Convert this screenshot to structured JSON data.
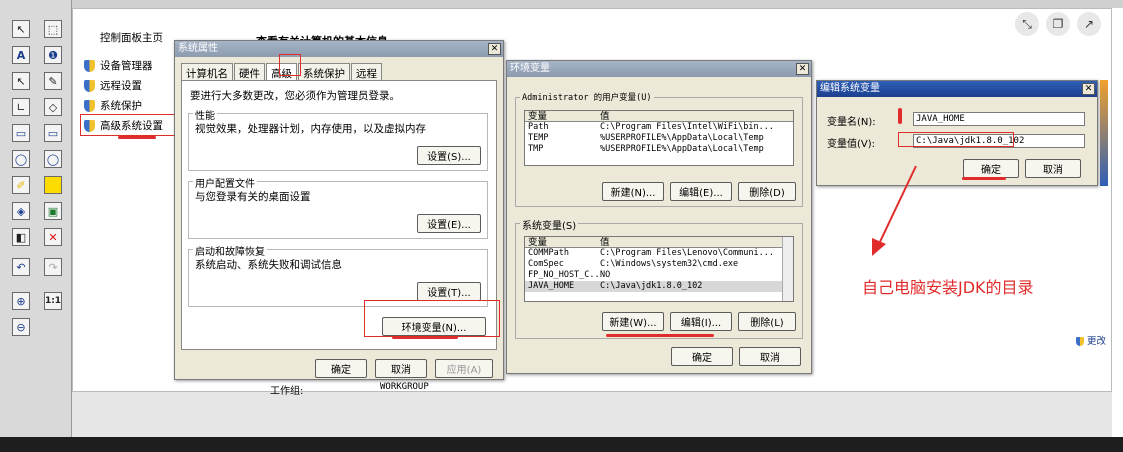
{
  "control_panel": {
    "home": "控制面板主页",
    "links": [
      "设备管理器",
      "远程设置",
      "系统保护",
      "高级系统设置"
    ],
    "heading": "查看有关计算机的基本信息",
    "workgroup_label": "工作组:",
    "workgroup_value": "WORKGROUP",
    "change_settings": "更改"
  },
  "sysprops": {
    "title": "系统属性",
    "tabs": [
      "计算机名",
      "硬件",
      "高级",
      "系统保护",
      "远程"
    ],
    "admin_note": "要进行大多数更改，您必须作为管理员登录。",
    "perf_label": "性能",
    "perf_desc": "视觉效果，处理器计划，内存使用，以及虚拟内存",
    "perf_btn": "设置(S)...",
    "profile_label": "用户配置文件",
    "profile_desc": "与您登录有关的桌面设置",
    "profile_btn": "设置(E)...",
    "startup_label": "启动和故障恢复",
    "startup_desc": "系统启动、系统失败和调试信息",
    "startup_btn": "设置(T)...",
    "env_btn": "环境变量(N)...",
    "ok": "确定",
    "cancel": "取消",
    "apply": "应用(A)"
  },
  "envvars": {
    "title": "环境变量",
    "user_group": "Administrator 的用户变量(U)",
    "col_var": "变量",
    "col_val": "值",
    "user_rows": [
      {
        "name": "Path",
        "value": "C:\\Program Files\\Intel\\WiFi\\bin..."
      },
      {
        "name": "TEMP",
        "value": "%USERPROFILE%\\AppData\\Local\\Temp"
      },
      {
        "name": "TMP",
        "value": "%USERPROFILE%\\AppData\\Local\\Temp"
      }
    ],
    "user_new": "新建(N)...",
    "user_edit": "编辑(E)...",
    "user_delete": "删除(D)",
    "sys_group": "系统变量(S)",
    "sys_rows": [
      {
        "name": "COMMPath",
        "value": "C:\\Program Files\\Lenovo\\Communi..."
      },
      {
        "name": "ComSpec",
        "value": "C:\\Windows\\system32\\cmd.exe"
      },
      {
        "name": "FP_NO_HOST_C...",
        "value": "NO"
      },
      {
        "name": "JAVA_HOME",
        "value": "C:\\Java\\jdk1.8.0_102"
      }
    ],
    "sys_new": "新建(W)...",
    "sys_edit": "编辑(I)...",
    "sys_delete": "删除(L)",
    "ok": "确定",
    "cancel": "取消"
  },
  "editvar": {
    "title": "编辑系统变量",
    "name_label": "变量名(N):",
    "name_value": "JAVA_HOME",
    "value_label": "变量值(V):",
    "value_value": "C:\\Java\\jdk1.8.0_102",
    "ok": "确定",
    "cancel": "取消"
  },
  "annotation": {
    "text": "自己电脑安装JDK的目录",
    "color": "#e12c2c"
  },
  "toolbar": {
    "zoom_label": "1:1"
  }
}
